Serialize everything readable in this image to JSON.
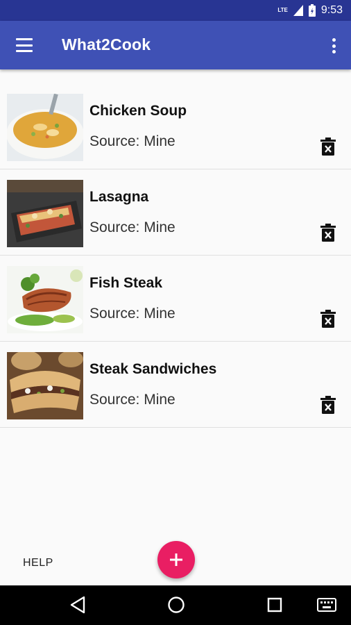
{
  "status_bar": {
    "network": "LTE",
    "time": "9:53"
  },
  "app_bar": {
    "title": "What2Cook"
  },
  "recipes": [
    {
      "name": "Chicken Soup",
      "source": "Source: Mine",
      "image": "chicken-soup-photo"
    },
    {
      "name": "Lasagna",
      "source": "Source: Mine",
      "image": "lasagna-photo"
    },
    {
      "name": "Fish Steak",
      "source": "Source: Mine",
      "image": "fish-steak-photo"
    },
    {
      "name": "Steak Sandwiches",
      "source": "Source: Mine",
      "image": "steak-sandwich-photo"
    }
  ],
  "footer": {
    "help_label": "HELP",
    "fab_icon": "plus-icon"
  },
  "colors": {
    "primary": "#3f51b5",
    "primary_dark": "#283593",
    "accent": "#e91e63"
  }
}
